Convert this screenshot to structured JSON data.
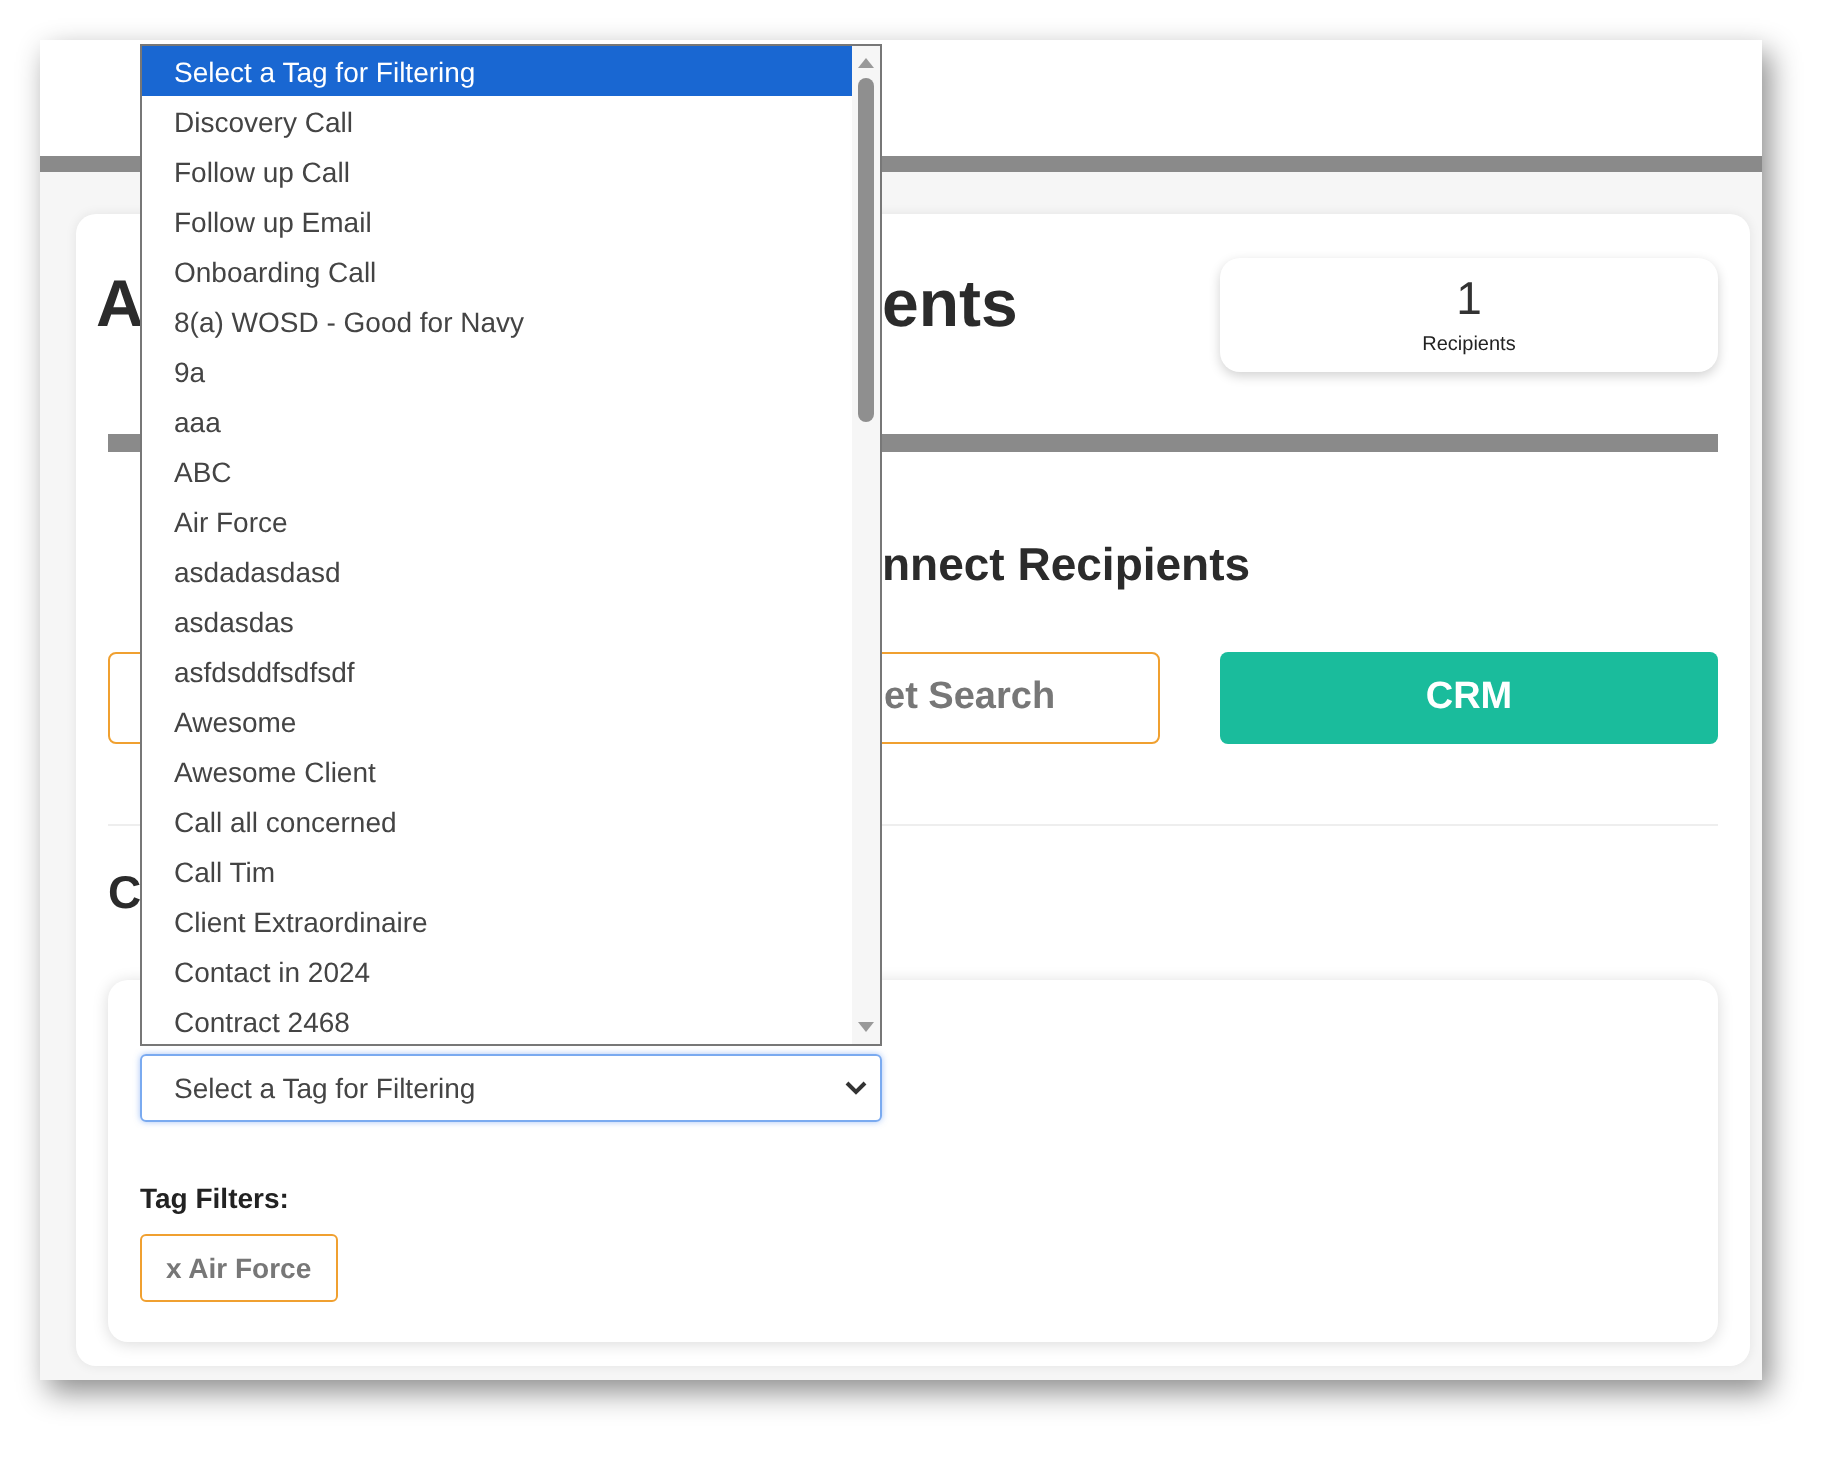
{
  "title": {
    "left": "A",
    "right": "ents"
  },
  "stat": {
    "value": "1",
    "label": "Recipients"
  },
  "section_heading": "nnect Recipients",
  "buttons": [
    {
      "label": "et Search",
      "kind": "outline"
    },
    {
      "label": "CRM",
      "kind": "primary"
    }
  ],
  "section2_heading": "C",
  "filter": {
    "select_value": "Select a Tag for Filtering",
    "tag_filters_label": "Tag Filters:",
    "tags": [
      {
        "label": "x Air Force"
      }
    ]
  },
  "dropdown": {
    "options": [
      {
        "label": "Select a Tag for Filtering",
        "selected": true
      },
      {
        "label": "Discovery Call",
        "selected": false
      },
      {
        "label": "Follow up Call",
        "selected": false
      },
      {
        "label": "Follow up Email",
        "selected": false
      },
      {
        "label": "Onboarding Call",
        "selected": false
      },
      {
        "label": "8(a) WOSD - Good for Navy",
        "selected": false
      },
      {
        "label": "9a",
        "selected": false
      },
      {
        "label": "aaa",
        "selected": false
      },
      {
        "label": "ABC",
        "selected": false
      },
      {
        "label": "Air Force",
        "selected": false
      },
      {
        "label": "asdadasdasd",
        "selected": false
      },
      {
        "label": "asdasdas",
        "selected": false
      },
      {
        "label": "asfdsddfsdfsdf",
        "selected": false
      },
      {
        "label": "Awesome",
        "selected": false
      },
      {
        "label": "Awesome Client",
        "selected": false
      },
      {
        "label": "Call all concerned",
        "selected": false
      },
      {
        "label": "Call Tim",
        "selected": false
      },
      {
        "label": "Client Extraordinaire",
        "selected": false
      },
      {
        "label": "Contact in 2024",
        "selected": false
      },
      {
        "label": "Contract 2468",
        "selected": false
      }
    ]
  }
}
